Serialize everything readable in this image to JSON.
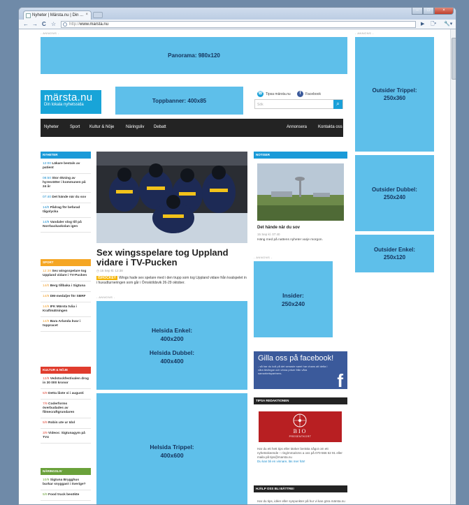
{
  "browser": {
    "tab_title": "Nyheter | Märsta.nu | Din ...",
    "tab_close": "×",
    "url_scheme": "http://",
    "url_host": "www.marsta.nu",
    "back": "←",
    "forward": "→",
    "reload": "C",
    "star": "☆",
    "play": "▶",
    "page_menu": "🗋▾",
    "tools_menu": "🔧▾",
    "minimize": "–",
    "maximize": "□",
    "close": "×"
  },
  "ads": {
    "label": "- ANNONS -",
    "panorama": "Panorama: 980x120",
    "topbanner": "Toppbanner: 400x85",
    "outsider_trippel": [
      "Outsider Trippel:",
      "250x360"
    ],
    "outsider_dubbel": [
      "Outsider Dubbel:",
      "250x240"
    ],
    "outsider_enkel": [
      "Outsider Enkel:",
      "250x120"
    ],
    "insider": [
      "Insider:",
      "250x240"
    ],
    "helsida_enkel": [
      "Helsida Enkel:",
      "400x200"
    ],
    "helsida_dubbel": [
      "Helsida Dubbel:",
      "400x400"
    ],
    "helsida_trippel": [
      "Helsida Trippel:",
      "400x600"
    ]
  },
  "site": {
    "logo_name": "märsta.nu",
    "logo_tagline": "Din lokala nyhetssida",
    "tipsa": "Tipsa märsta.nu",
    "facebook": "Facebook",
    "search_placeholder": "Sök",
    "search_icon": "⌕"
  },
  "menu": {
    "left": [
      "Nyheter",
      "Sport",
      "Kultur & Nöje",
      "Näringsliv",
      "Debatt"
    ],
    "right": [
      "Annonsera",
      "Kontakta oss"
    ]
  },
  "sidebar": {
    "nyheter": {
      "title": "NYHETER",
      "color": "#1a9ad8",
      "items": [
        {
          "time": "12:00",
          "text": "Läkare bestals av patient"
        },
        {
          "time": "08:50",
          "text": "Stor ökning av hyresrätter i kommunen på 24 år"
        },
        {
          "time": "07:40",
          "text": "Det hände när du sov"
        },
        {
          "time": "14/0",
          "text": "Pådrag för befarad tågolycka"
        },
        {
          "time": "14/9",
          "text": "Vandaler slog till på Norrbackaskolan igen"
        }
      ]
    },
    "sport": {
      "title": "SPORT",
      "color": "#f5a623",
      "items": [
        {
          "time": "12:38",
          "text": "Sex wingsspelare tog Uppland vidare i TV-Pucken"
        },
        {
          "time": "14/0",
          "text": "Berg tillbaka i Sigtuna"
        },
        {
          "time": "14/9",
          "text": "DM-medaljer för SBRF"
        },
        {
          "time": "14/9",
          "text": "IFK Märsta tvåa i Kraftmätningen"
        },
        {
          "time": "14/9",
          "text": "Bara Arlanda kvar i toppracet"
        }
      ]
    },
    "kultur": {
      "title": "KULTUR & NÖJE",
      "color": "#e03c2d",
      "items": [
        {
          "time": "12/9",
          "text": "Vedstockfestivalen drog in 30 000 kronor"
        },
        {
          "time": "5/9",
          "text": "Detta låste vi i augusti"
        },
        {
          "time": "7/9",
          "text": "Coderforms överbudades av filmecraftgrundaren"
        },
        {
          "time": "5/9",
          "text": "Robin ute ur Idol"
        },
        {
          "time": "3/9",
          "text": "Videos: Sigtunagym på TV4"
        }
      ]
    },
    "naringsliv": {
      "title": "NÄRINGSLIV",
      "color": "#6aa13a",
      "items": [
        {
          "time": "10/9",
          "text": "Sigtuna Brygghus burkar snyggast i Sverige?"
        },
        {
          "time": "5/9",
          "text": "Food truck besökte"
        }
      ]
    }
  },
  "article": {
    "headline": "Sex wingsspelare tog Uppland vidare i TV-Pucken",
    "meta": "15 Sep kl. 12:38",
    "badge": "ISHOCKEY",
    "lead": "Wings hade sex spelare med i den trupp som tog Uppland vidare från kvalspelet in i huvudturneringen som går i Örnsköldsvik 26-29 oktober."
  },
  "notiser": {
    "title": "NOTISER",
    "item_title": "Det hände när du sov",
    "item_date": "15 Sep kl. 07:40",
    "item_text": "Häng med på nattens nyheter varje morgon."
  },
  "facebook_box": {
    "heading": "Gilla oss på facebook!",
    "sub": "- så har du koll på det senaste samt har chans att delta i våra tävlingar och vinna priser från våra samarbetspartners.",
    "f": "f"
  },
  "tipsa_box": {
    "title": "TIPSA REDAKTIONEN",
    "bio": "BIO",
    "bio_sub": "PRESENTKORT",
    "text": "Har du ett hett tips eller tänker berätta något om ett nyhetsskeende – ring/mma/sms a oss på 070-566 62 91 eller maila på tips@marsta.nu",
    "link": "Du kan bli en vinnare, läs mer här!"
  },
  "hjalp_box": {
    "title": "HJÄLP OSS BLI BÄTTRE!",
    "text": "Har du tips, idéer eller synpunkter på hur vi kan göra märsta.nu ännu bättre? Kanske är"
  },
  "colors": {
    "ad": "#5ebfea",
    "brand": "#18a4d8",
    "menu": "#232323",
    "facebook": "#3b5a9b",
    "bio": "#b81f22"
  }
}
